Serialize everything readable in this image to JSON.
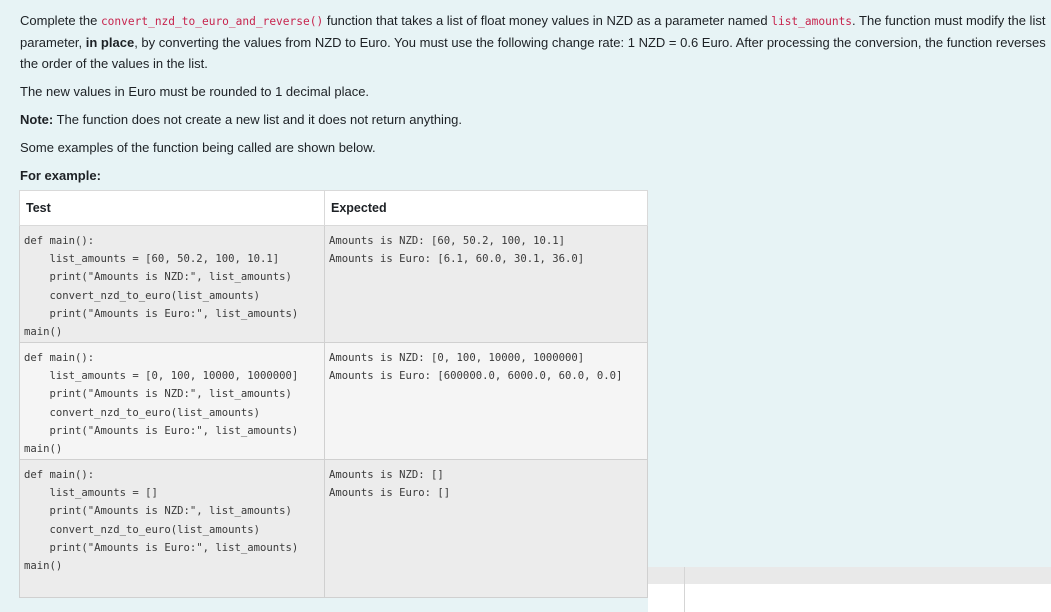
{
  "intro": {
    "part1": "Complete the ",
    "fn_name": "convert_nzd_to_euro_and_reverse()",
    "part2": " function that takes a list of float money values in NZD as a parameter named ",
    "param_name": "list_amounts",
    "part3": ". The function must modify the list parameter, ",
    "in_place": "in place",
    "part4": ", by converting the values from NZD to Euro. You must use the following change rate: 1 NZD = 0.6 Euro. After processing the conversion, the function reverses the order of the values in the list."
  },
  "rounding_text": "The new values in Euro must be rounded to 1 decimal place.",
  "note": {
    "label": "Note:",
    "text": " The function does not create a new list and it does not return anything."
  },
  "examples_intro": "Some examples of the function being called are shown below.",
  "for_example": "For example:",
  "table": {
    "headers": [
      "Test",
      "Expected"
    ],
    "rows": [
      {
        "test": "def main():\n    list_amounts = [60, 50.2, 100, 10.1]\n    print(\"Amounts is NZD:\", list_amounts)\n    convert_nzd_to_euro(list_amounts)\n    print(\"Amounts is Euro:\", list_amounts)\nmain()",
        "expected": "Amounts is NZD: [60, 50.2, 100, 10.1]\nAmounts is Euro: [6.1, 60.0, 30.1, 36.0]"
      },
      {
        "test": "def main():\n    list_amounts = [0, 100, 10000, 1000000]\n    print(\"Amounts is NZD:\", list_amounts)\n    convert_nzd_to_euro(list_amounts)\n    print(\"Amounts is Euro:\", list_amounts)\nmain()",
        "expected": "Amounts is NZD: [0, 100, 10000, 1000000]\nAmounts is Euro: [600000.0, 6000.0, 60.0, 0.0]"
      },
      {
        "test": "def main():\n    list_amounts = []\n    print(\"Amounts is NZD:\", list_amounts)\n    convert_nzd_to_euro(list_amounts)\n    print(\"Amounts is Euro:\", list_amounts)\nmain()",
        "expected": "Amounts is NZD: []\nAmounts is Euro: []"
      }
    ]
  }
}
